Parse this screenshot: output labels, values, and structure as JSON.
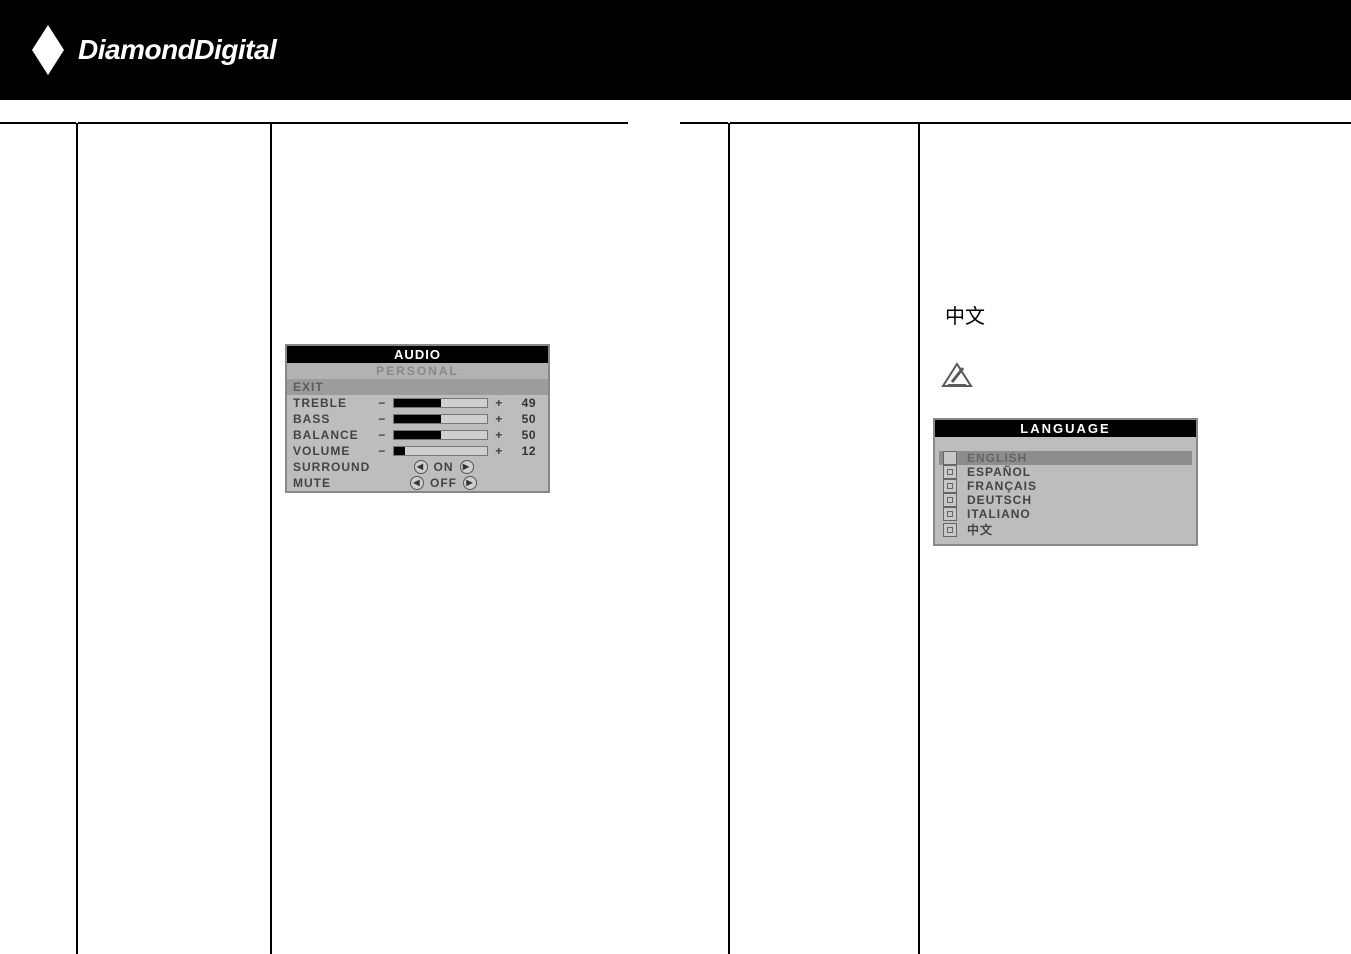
{
  "brand": "DiamondDigital",
  "audio": {
    "title": "AUDIO",
    "subtitle": "PERSONAL",
    "exit": "EXIT",
    "sliders": [
      {
        "label": "TREBLE",
        "value": 49,
        "fill": 50
      },
      {
        "label": "BASS",
        "value": 50,
        "fill": 50
      },
      {
        "label": "BALANCE",
        "value": 50,
        "fill": 50
      },
      {
        "label": "VOLUME",
        "value": 12,
        "fill": 12
      }
    ],
    "toggles": [
      {
        "label": "SURROUND",
        "state": "ON"
      },
      {
        "label": "MUTE",
        "state": "OFF"
      }
    ]
  },
  "cjk_label": "中文",
  "language": {
    "title": "LANGUAGE",
    "items": [
      {
        "label": "ENGLISH",
        "selected": true
      },
      {
        "label": "ESPAÑOL",
        "selected": false
      },
      {
        "label": "FRANÇAIS",
        "selected": false
      },
      {
        "label": "DEUTSCH",
        "selected": false
      },
      {
        "label": "ITALIANO",
        "selected": false
      },
      {
        "label": "中文",
        "selected": false
      }
    ]
  }
}
